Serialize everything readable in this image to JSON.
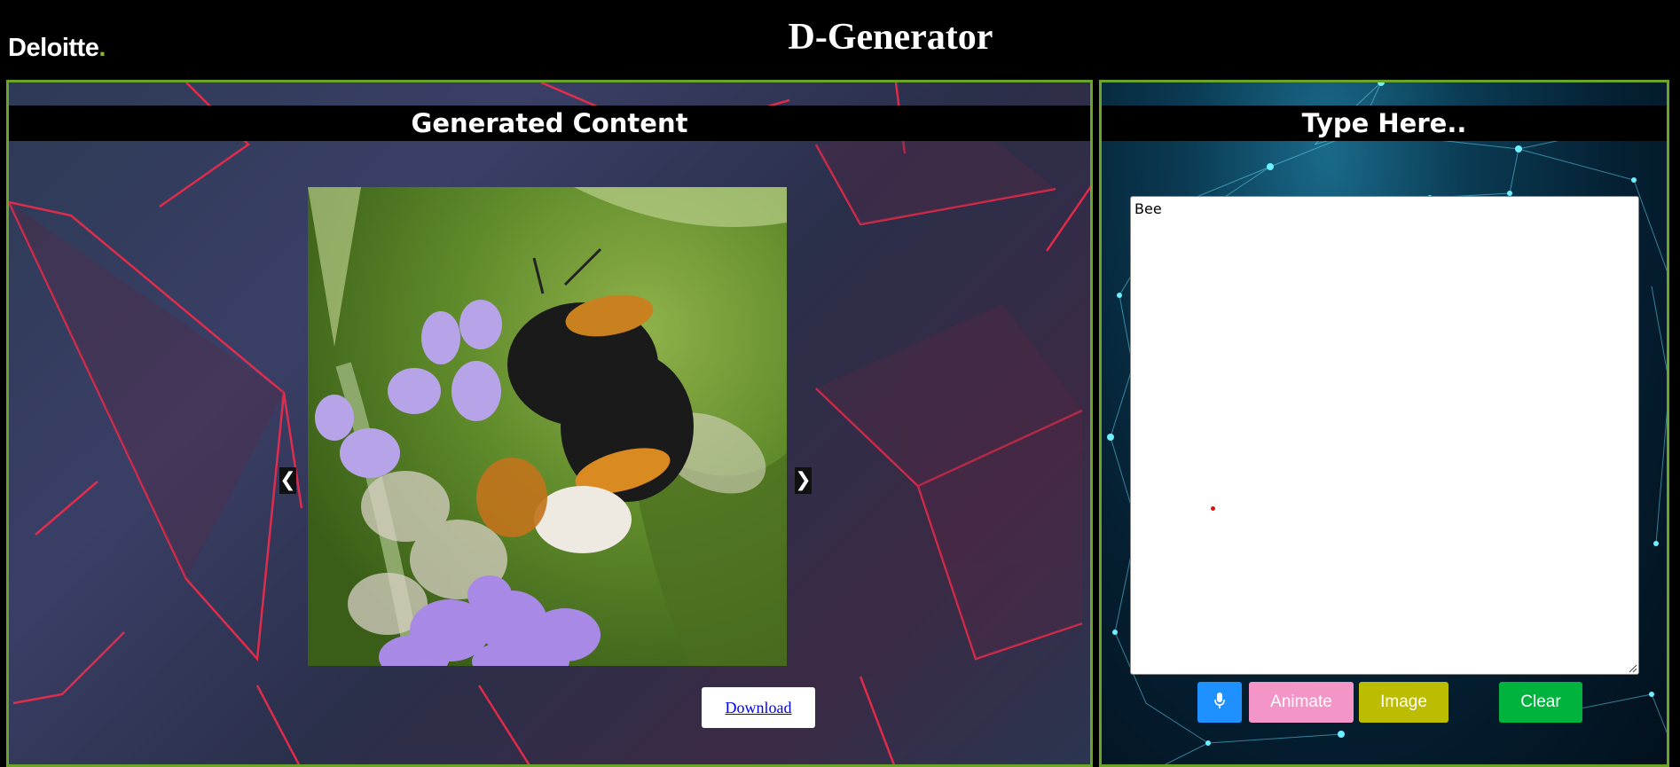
{
  "header": {
    "brand_name": "Deloitte",
    "brand_dot": ".",
    "app_title": "D-Generator"
  },
  "left_panel": {
    "title": "Generated Content",
    "prev_arrow": "❮",
    "next_arrow": "❯",
    "download_label": "Download"
  },
  "right_panel": {
    "title": "Type Here..",
    "prompt_value": "Bee",
    "buttons": {
      "mic_icon": "microphone-icon",
      "animate_label": "Animate",
      "image_label": "Image",
      "clear_label": "Clear"
    }
  },
  "colors": {
    "border_accent": "#6aa52a",
    "brand_dot": "#86bc25",
    "mic": "#1e90ff",
    "animate": "#f395c7",
    "image": "#bcbc00",
    "clear": "#00b33c"
  }
}
